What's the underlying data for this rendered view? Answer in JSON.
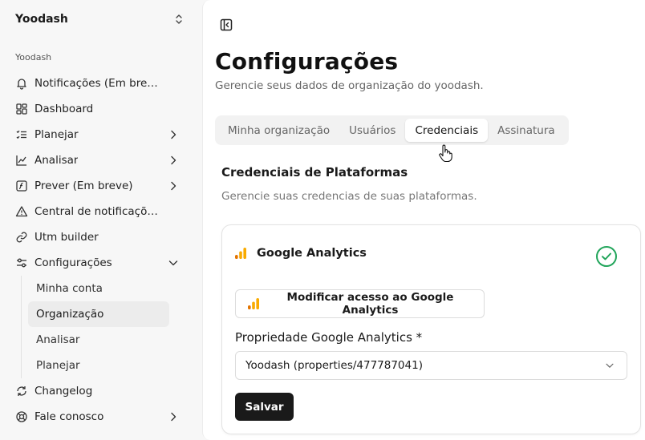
{
  "sidebar": {
    "workspace": "Yoodash",
    "group_label": "Yoodash",
    "items": [
      {
        "label": "Notificações (Em breve)",
        "icon": "bell-icon"
      },
      {
        "label": "Dashboard",
        "icon": "dashboard-icon"
      },
      {
        "label": "Planejar",
        "icon": "list-check-icon"
      },
      {
        "label": "Analisar",
        "icon": "line-chart-icon"
      },
      {
        "label": "Prever (Em breve)",
        "icon": "forecast-icon"
      },
      {
        "label": "Central de notificações",
        "icon": "warning-icon"
      },
      {
        "label": "Utm builder",
        "icon": "link-icon"
      },
      {
        "label": "Configurações",
        "icon": "settings-icon"
      },
      {
        "label": "Changelog",
        "icon": "refresh-icon"
      },
      {
        "label": "Fale conosco",
        "icon": "support-icon"
      }
    ],
    "sub_items": [
      {
        "label": "Minha conta"
      },
      {
        "label": "Organização"
      },
      {
        "label": "Analisar"
      },
      {
        "label": "Planejar"
      }
    ]
  },
  "header": {
    "title": "Configurações",
    "subtitle": "Gerencie seus dados de organização do yoodash."
  },
  "tabs": [
    {
      "label": "Minha organização"
    },
    {
      "label": "Usuários"
    },
    {
      "label": "Credenciais"
    },
    {
      "label": "Assinatura"
    }
  ],
  "active_tab": "Credenciais",
  "section": {
    "title": "Credenciais de Plataformas",
    "description": "Gerencie suas credencias de suas plataformas."
  },
  "card": {
    "title": "Google Analytics",
    "modify_button": "Modificar acesso ao Google Analytics",
    "field_label": "Propriedade Google Analytics *",
    "select_value": "Yoodash (properties/477787041)",
    "save_button": "Salvar"
  },
  "colors": {
    "ga_orange": "#F9AB00",
    "ga_dark_orange": "#E37400",
    "success_green": "#22a55b",
    "primary_button": "#1a1a1a"
  }
}
